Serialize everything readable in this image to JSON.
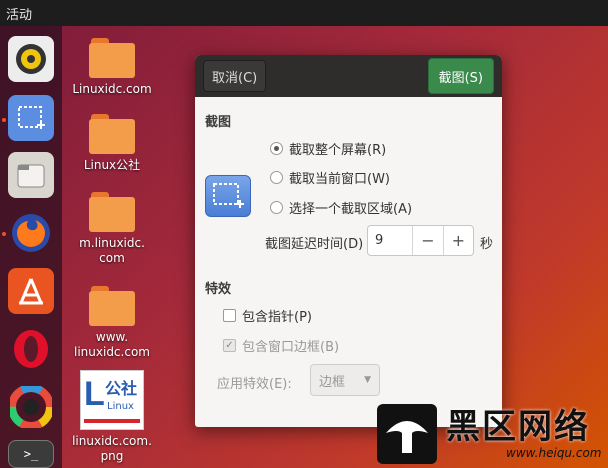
{
  "topbar": {
    "activities": "活动"
  },
  "desktop": {
    "items": [
      {
        "label": "Linuxidc.com"
      },
      {
        "label": "Linux公社"
      },
      {
        "label": "m.linuxidc.\ncom"
      },
      {
        "label": "www.\nlinuxidc.com"
      },
      {
        "label": "linuxidc.com.\npng"
      }
    ],
    "thumb_text": "公社",
    "thumb_sub": "Linux"
  },
  "dialog": {
    "cancel_label": "取消(C)",
    "capture_label": "截图(S)",
    "section_screenshot": "截图",
    "options": [
      {
        "label": "截取整个屏幕(R)",
        "checked": true
      },
      {
        "label": "截取当前窗口(W)",
        "checked": false
      },
      {
        "label": "选择一个截取区域(A)",
        "checked": false
      }
    ],
    "delay_label": "截图延迟时间(D)",
    "delay_value": "9",
    "delay_minus": "−",
    "delay_plus": "+",
    "delay_unit": "秒",
    "section_effects": "特效",
    "include_pointer": "包含指针(P)",
    "include_border": "包含窗口边框(B)",
    "apply_effect_label": "应用特效(E):",
    "effect_value": "边框"
  },
  "watermark": {
    "text": "黑区网络",
    "url": "www.heiqu.com"
  },
  "colors": {
    "accent_green": "#3a8a4c",
    "ubuntu_orange": "#e95420"
  }
}
